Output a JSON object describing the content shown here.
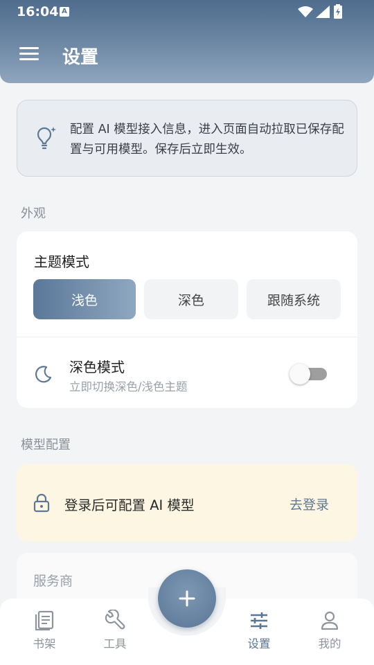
{
  "status_bar": {
    "time": "16:04",
    "a_icon": "A"
  },
  "header": {
    "title": "设置"
  },
  "info": {
    "text": "配置 AI 模型接入信息，进入页面自动拉取已保存配置与可用模型。保存后立即生效。"
  },
  "appearance": {
    "section_label": "外观",
    "theme_title": "主题模式",
    "options": [
      "浅色",
      "深色",
      "跟随系统"
    ],
    "selected": "浅色",
    "dark_mode_title": "深色模式",
    "dark_mode_subtitle": "立即切换深色/浅色主题",
    "dark_mode_on": false
  },
  "model": {
    "section_label": "模型配置",
    "login_text": "登录后可配置 AI 模型",
    "login_link": "去登录",
    "provider_label": "服务商"
  },
  "nav": {
    "items": [
      {
        "label": "书架",
        "icon": "bookshelf-icon"
      },
      {
        "label": "工具",
        "icon": "wrench-icon"
      },
      {
        "label": "设置",
        "icon": "sliders-icon"
      },
      {
        "label": "我的",
        "icon": "user-icon"
      }
    ],
    "active": "设置"
  },
  "colors": {
    "accent": "#5b7797",
    "header": "#5f7b9b",
    "login_bg": "#fdf6e3"
  }
}
